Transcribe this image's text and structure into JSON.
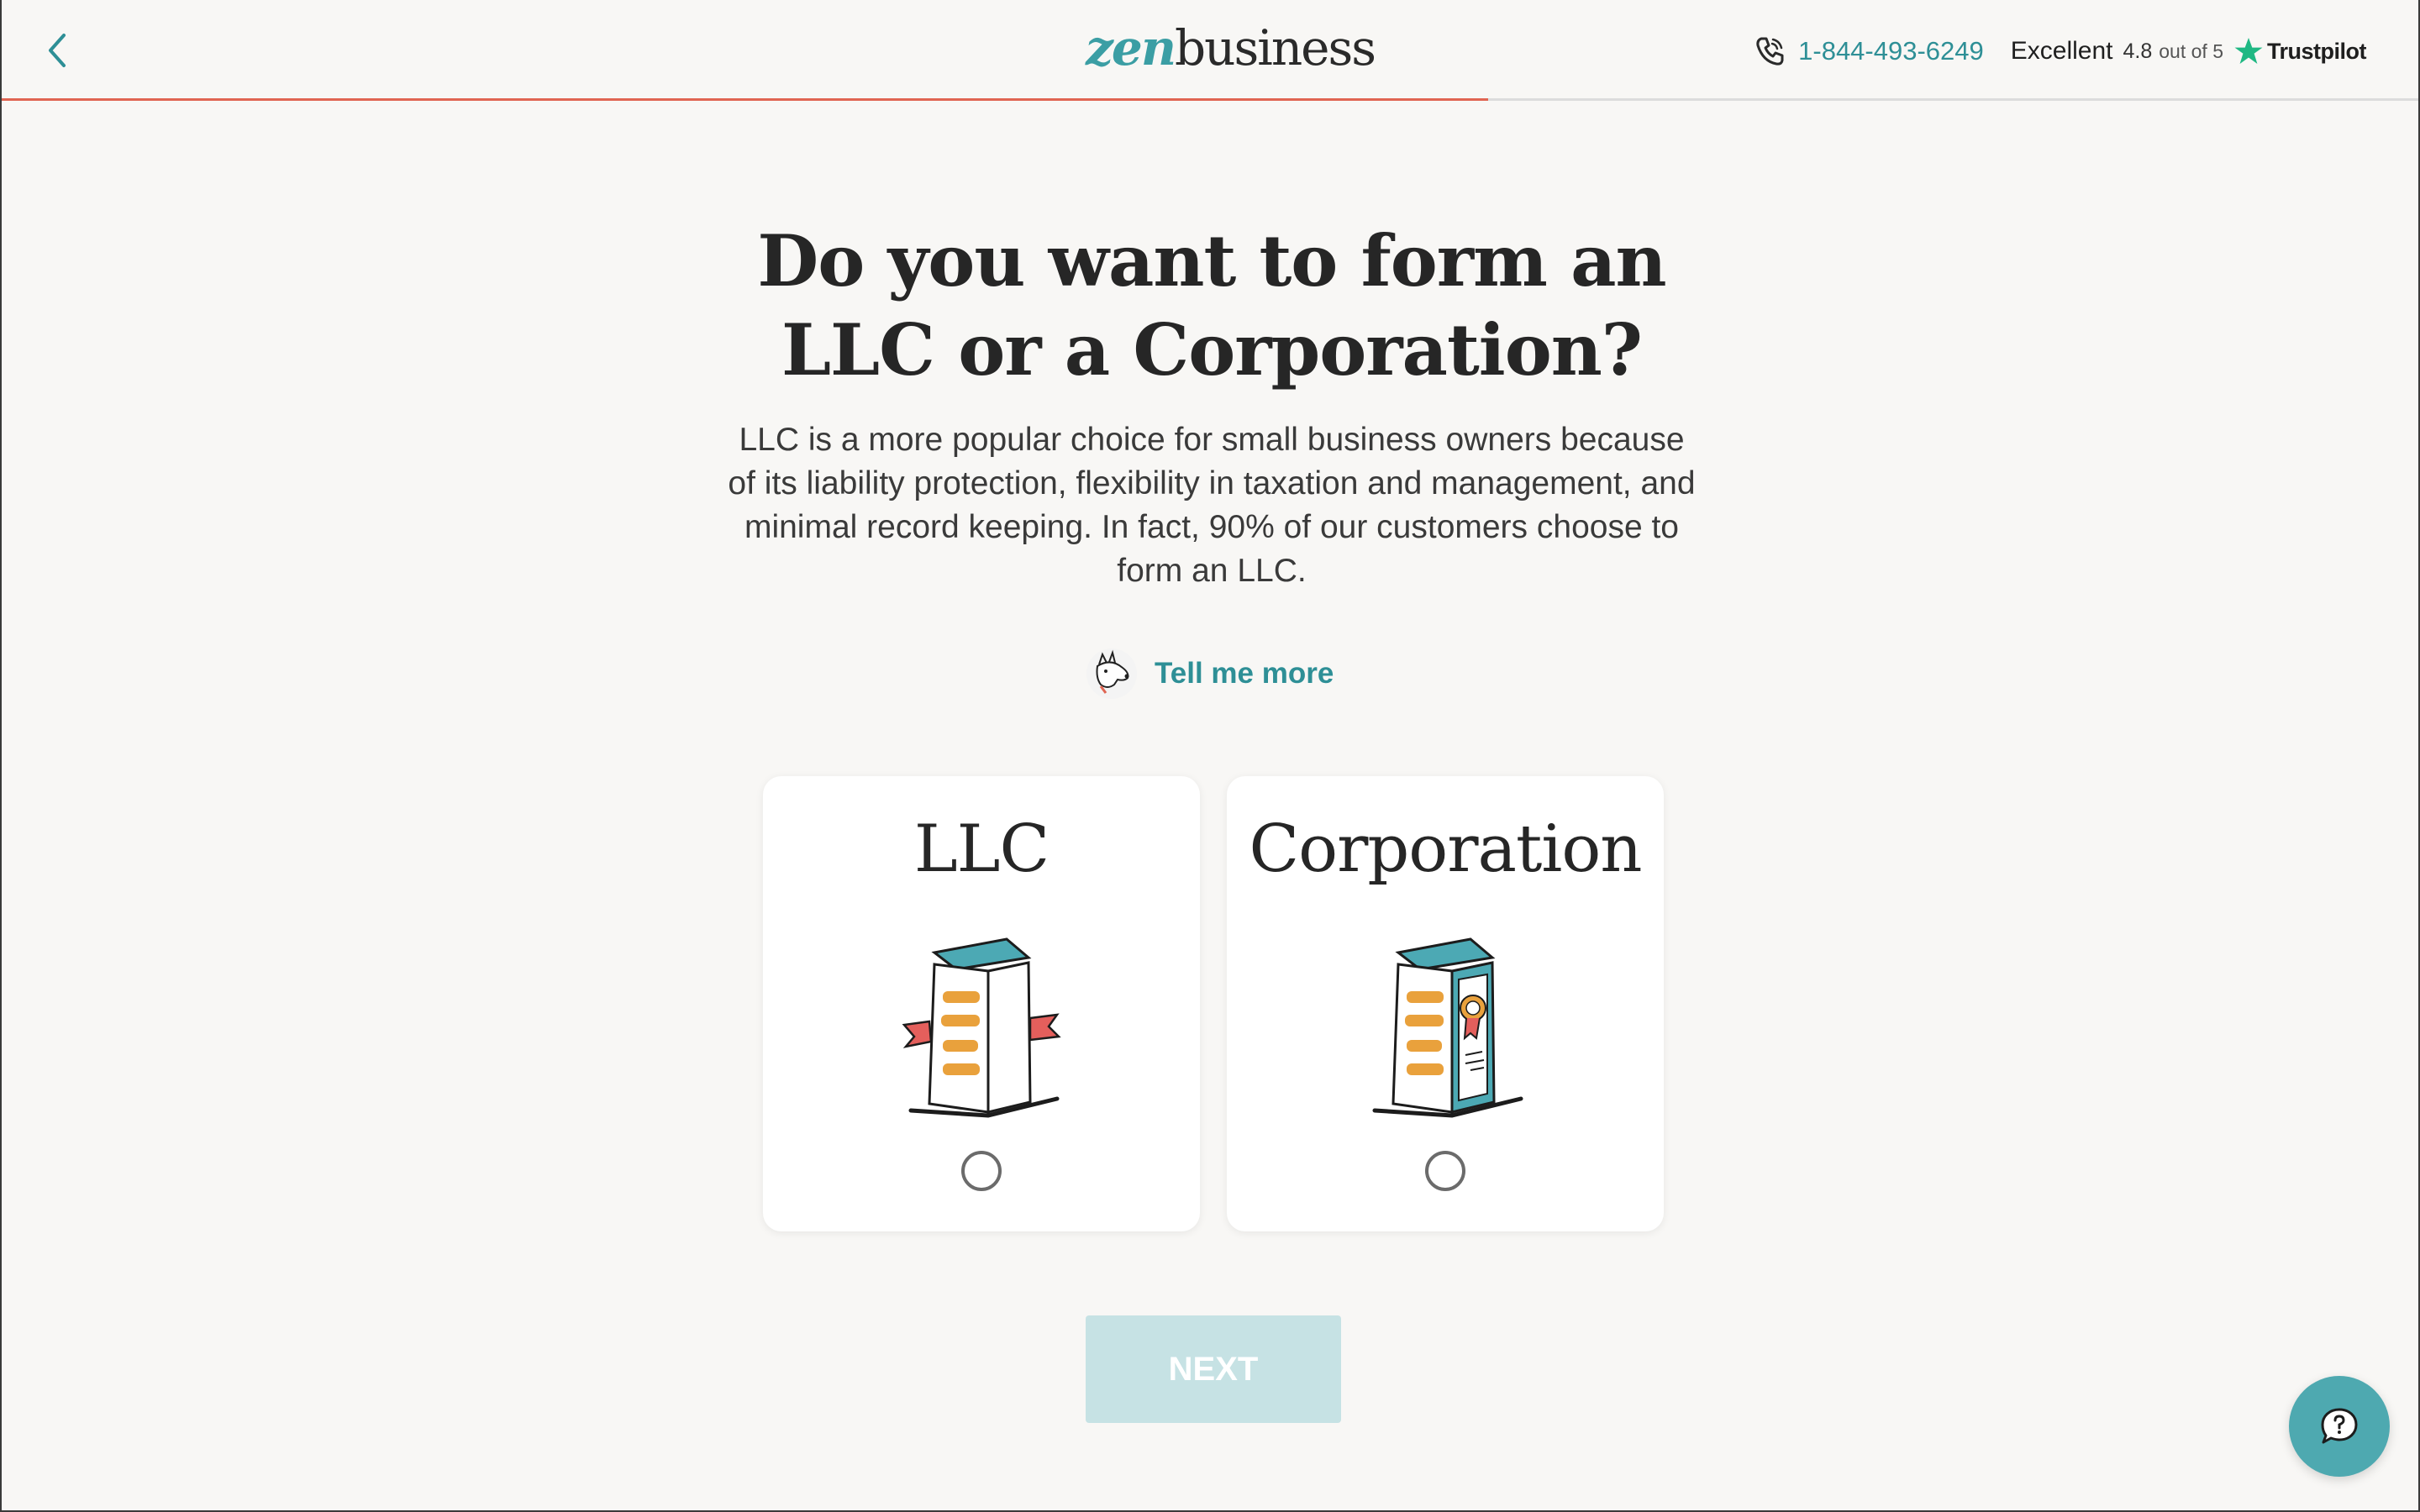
{
  "header": {
    "logo": {
      "part1": "zen",
      "part2": "business"
    },
    "phone": "1-844-493-6249",
    "trustpilot": {
      "rating_word": "Excellent",
      "score": "4.8",
      "out_of": "out of 5",
      "brand": "Trustpilot"
    },
    "progress": 0.615
  },
  "main": {
    "headline": "Do you want to form an LLC or a Corporation?",
    "description": "LLC is a more popular choice for small business owners because of its liability protection, flexibility in taxation and management, and minimal record keeping. In fact, 90% of our customers choose to form an LLC.",
    "tell_more": "Tell me more",
    "options": [
      {
        "label": "LLC",
        "selected": false
      },
      {
        "label": "Corporation",
        "selected": false
      }
    ],
    "next_label": "NEXT"
  },
  "colors": {
    "teal": "#2e8f96",
    "progress": "#e06552",
    "next_disabled": "#c6e2e4",
    "background": "#f8f7f5"
  },
  "icons": [
    "back-chevron",
    "phone-icon",
    "trustpilot-star",
    "dog-avatar",
    "building-llc",
    "building-corporation",
    "chat-question"
  ]
}
